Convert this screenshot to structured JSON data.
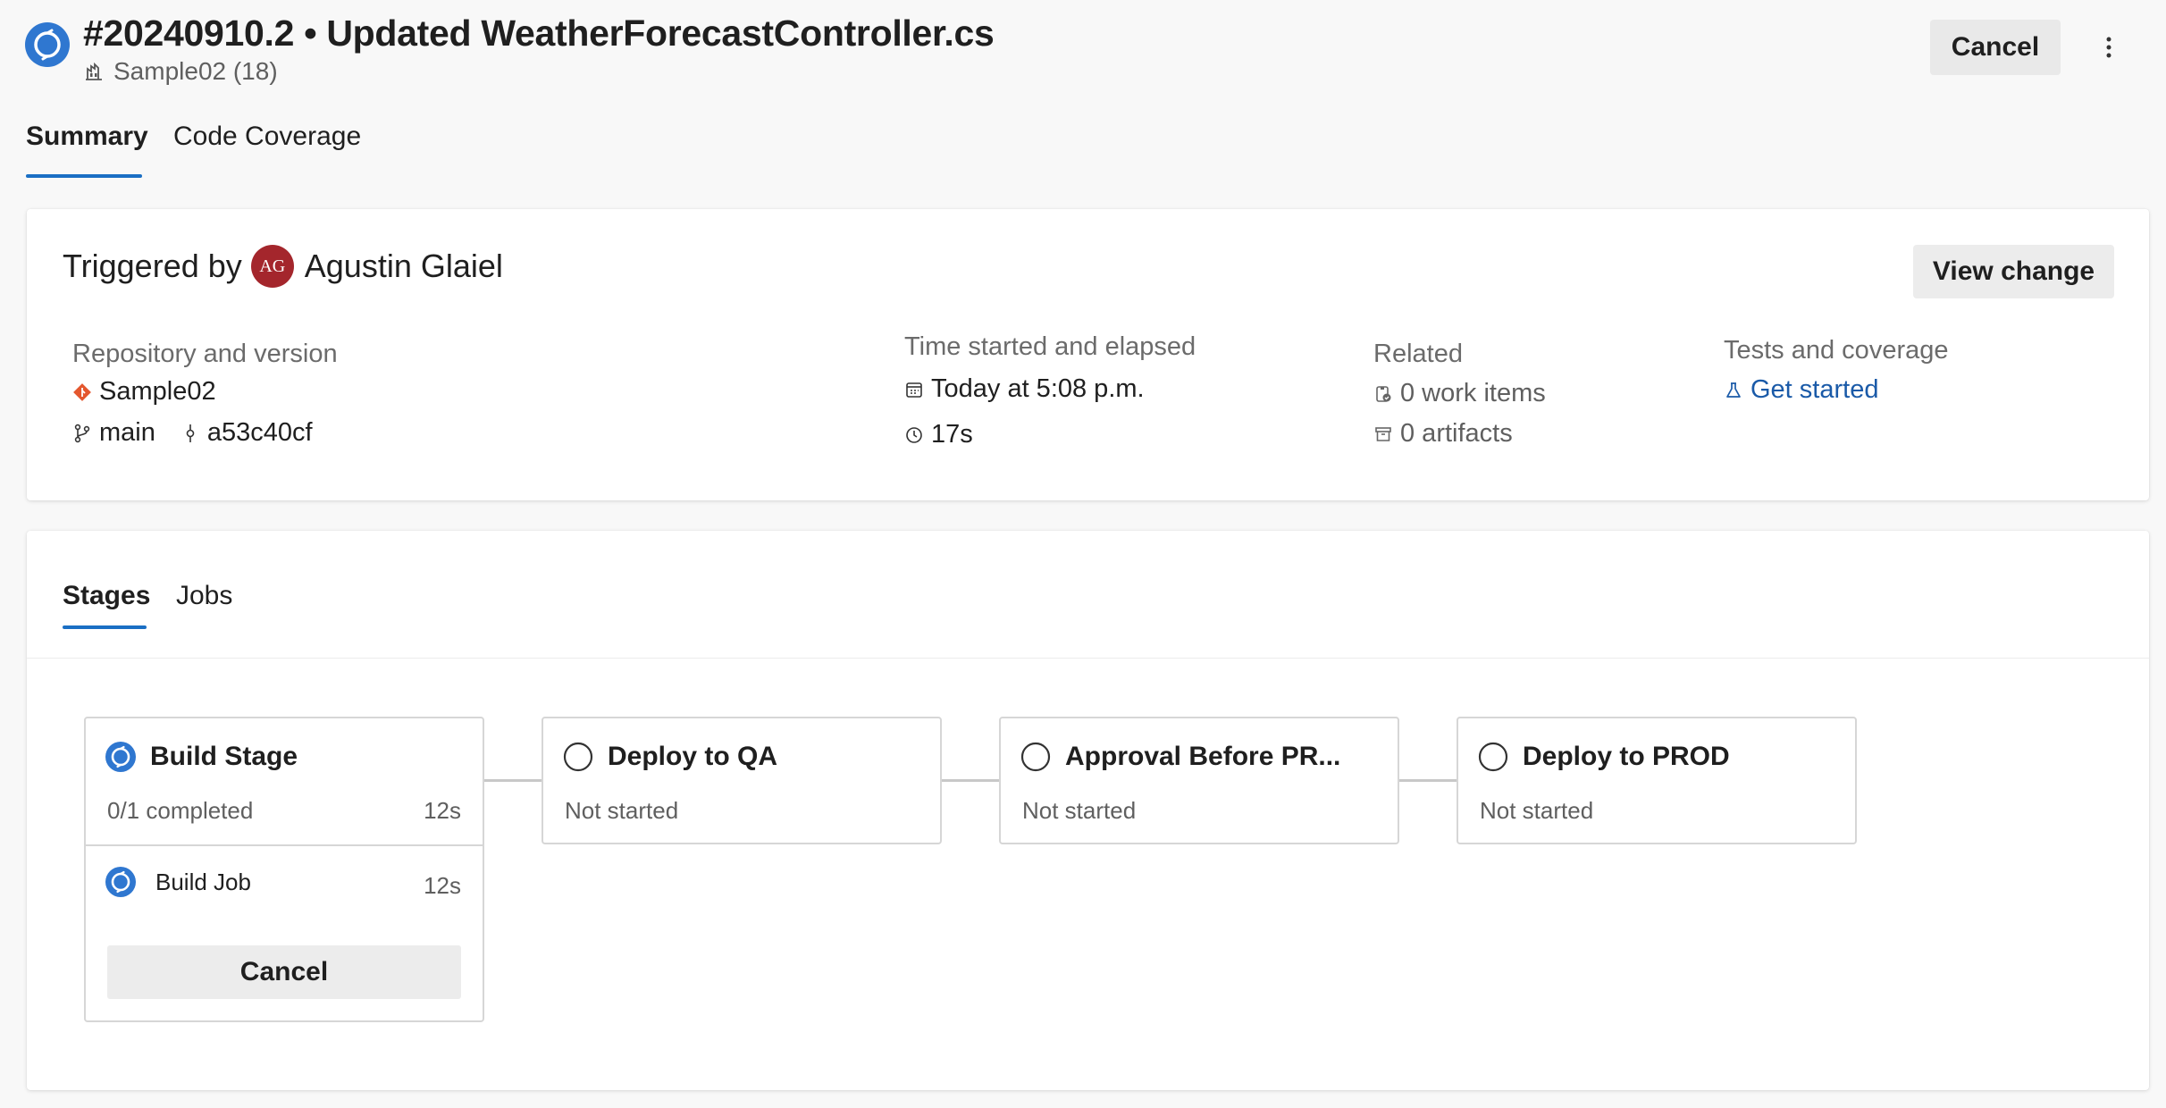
{
  "header": {
    "title": "#20240910.2 • Updated WeatherForecastController.cs",
    "pipeline": "Sample02 (18)",
    "cancel_label": "Cancel"
  },
  "page_tabs": [
    {
      "label": "Summary",
      "selected": true
    },
    {
      "label": "Code Coverage",
      "selected": false
    }
  ],
  "summary": {
    "triggered_by_label": "Triggered by",
    "user_initials": "AG",
    "user_name": "Agustin Glaiel",
    "view_change_label": "View change",
    "repository": {
      "heading": "Repository and version",
      "name": "Sample02",
      "branch": "main",
      "commit": "a53c40cf"
    },
    "time": {
      "heading": "Time started and elapsed",
      "started": "Today at 5:08 p.m.",
      "elapsed": "17s"
    },
    "related": {
      "heading": "Related",
      "work_items": "0 work items",
      "artifacts": "0 artifacts"
    },
    "tests": {
      "heading": "Tests and coverage",
      "link": "Get started"
    }
  },
  "stage_tabs": [
    {
      "label": "Stages",
      "selected": true
    },
    {
      "label": "Jobs",
      "selected": false
    }
  ],
  "stages": [
    {
      "name": "Build Stage",
      "status": "running",
      "progress": "0/1 completed",
      "duration": "12s",
      "jobs": [
        {
          "name": "Build Job",
          "duration": "12s",
          "status": "running"
        }
      ],
      "cancel_label": "Cancel"
    },
    {
      "name": "Deploy to QA",
      "status": "not-started",
      "progress": "Not started"
    },
    {
      "name": "Approval Before PR...",
      "status": "not-started",
      "progress": "Not started"
    },
    {
      "name": "Deploy to PROD",
      "status": "not-started",
      "progress": "Not started"
    }
  ],
  "colors": {
    "accent": "#1a6fc4",
    "running": "#2f77d0",
    "avatar": "#a4262c",
    "link": "#1a5aa8",
    "git_icon": "#e4572e"
  }
}
